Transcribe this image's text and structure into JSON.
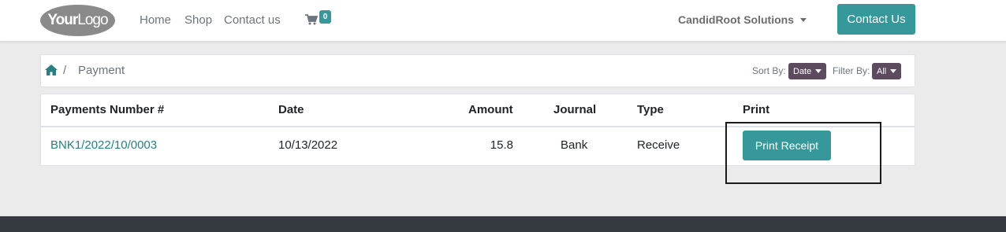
{
  "header": {
    "logo": {
      "bold": "Your",
      "thin": "Logo"
    },
    "nav": [
      "Home",
      "Shop",
      "Contact us"
    ],
    "cart_count": "0",
    "company": "CandidRoot Solutions",
    "contact_button": "Contact Us"
  },
  "breadcrumb": {
    "separator": "/",
    "current": "Payment",
    "sort_label": "Sort By:",
    "sort_value": "Date",
    "filter_label": "Filter By:",
    "filter_value": "All"
  },
  "table": {
    "columns": [
      "Payments Number #",
      "Date",
      "Amount",
      "Journal",
      "Type",
      "Print"
    ],
    "rows": [
      {
        "number": "BNK1/2022/10/0003",
        "date": "10/13/2022",
        "amount": "15.8",
        "journal": "Bank",
        "type": "Receive",
        "print_label": "Print Receipt"
      }
    ]
  },
  "colors": {
    "accent": "#36989a",
    "dropdown": "#5c4a5e",
    "footer": "#343a40"
  }
}
